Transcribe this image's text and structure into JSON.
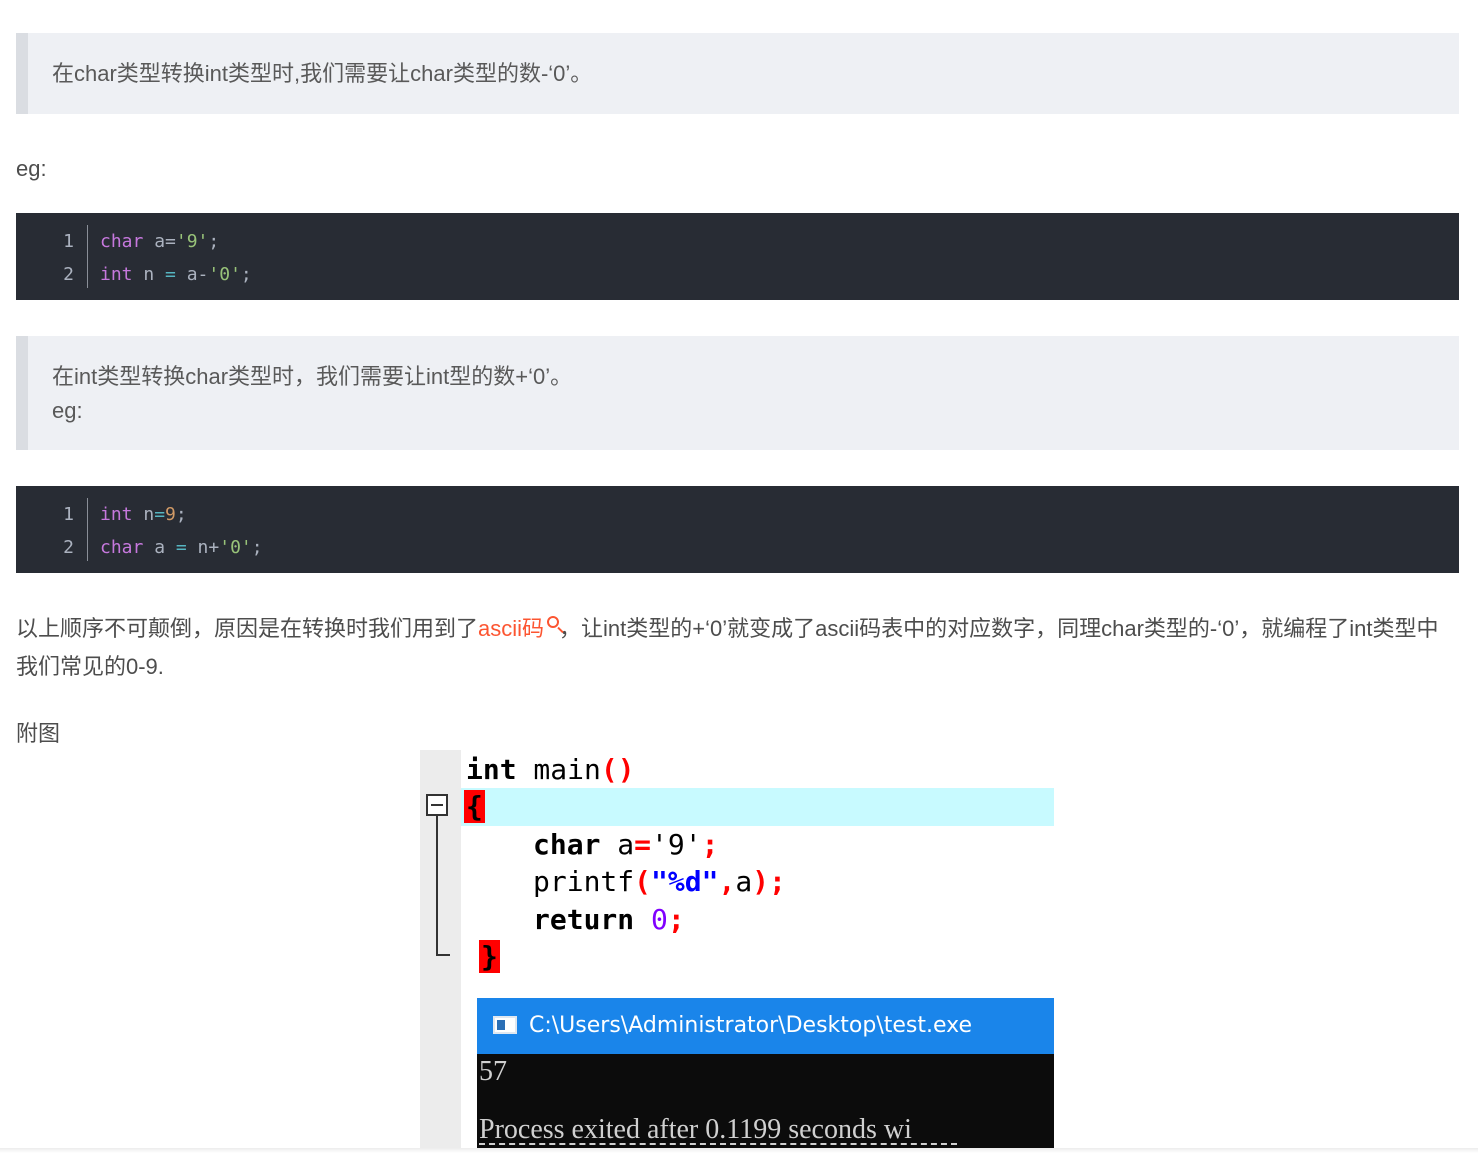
{
  "article": {
    "quote1": "在char类型转换int类型时,我们需要让char类型的数-‘0’。",
    "eg1": "eg:",
    "code1": {
      "line_numbers": [
        "1",
        "2"
      ],
      "line1": {
        "kw": "char",
        "rest1": " a=",
        "str": "'9'",
        "rest2": ";"
      },
      "line2": {
        "kw": "int",
        "rest1": " n ",
        "op": "=",
        "rest2": " a-",
        "str": "'0'",
        "rest3": ";"
      }
    },
    "quote2_line1": "在int类型转换char类型时，我们需要让int型的数+‘0’。",
    "quote2_line2": "eg:",
    "code2": {
      "line_numbers": [
        "1",
        "2"
      ],
      "line1": {
        "kw": "int",
        "rest1": " n",
        "op": "=",
        "num": "9",
        "rest2": ";"
      },
      "line2": {
        "kw": "char",
        "rest1": " a ",
        "op": "=",
        "rest2": " n+",
        "str": "'0'",
        "rest3": ";"
      }
    },
    "para_before_link": "以上顺序不可颠倒，原因是在转换时我们用到了",
    "para_link": "ascii码",
    "para_after_link": "，让int类型的+‘0’就变成了ascii码表中的对应数字，同理char类型的-‘0’，就编程了int类型中我们常见的0-9.",
    "figure_caption": "附图"
  },
  "ide": {
    "line1_kw": "int",
    "line1_fn": " main",
    "line1_paren": "()",
    "line2_brace": "{",
    "line3_kw": "char",
    "line3_a": " a",
    "line3_eq": "=",
    "line3_str": "'9'",
    "line3_semi": ";",
    "line4_fn": "printf",
    "line4_open": "(",
    "line4_str": "\"%d\"",
    "line4_comma": ",",
    "line4_a": "a",
    "line4_close": ");",
    "line5_kw": "return",
    "line5_num": " 0",
    "line5_semi": ";",
    "line6_brace": "}"
  },
  "console": {
    "title": "C:\\Users\\Administrator\\Desktop\\test.exe",
    "output": "57",
    "status_line": "Process exited after 0.1199 seconds wi"
  }
}
